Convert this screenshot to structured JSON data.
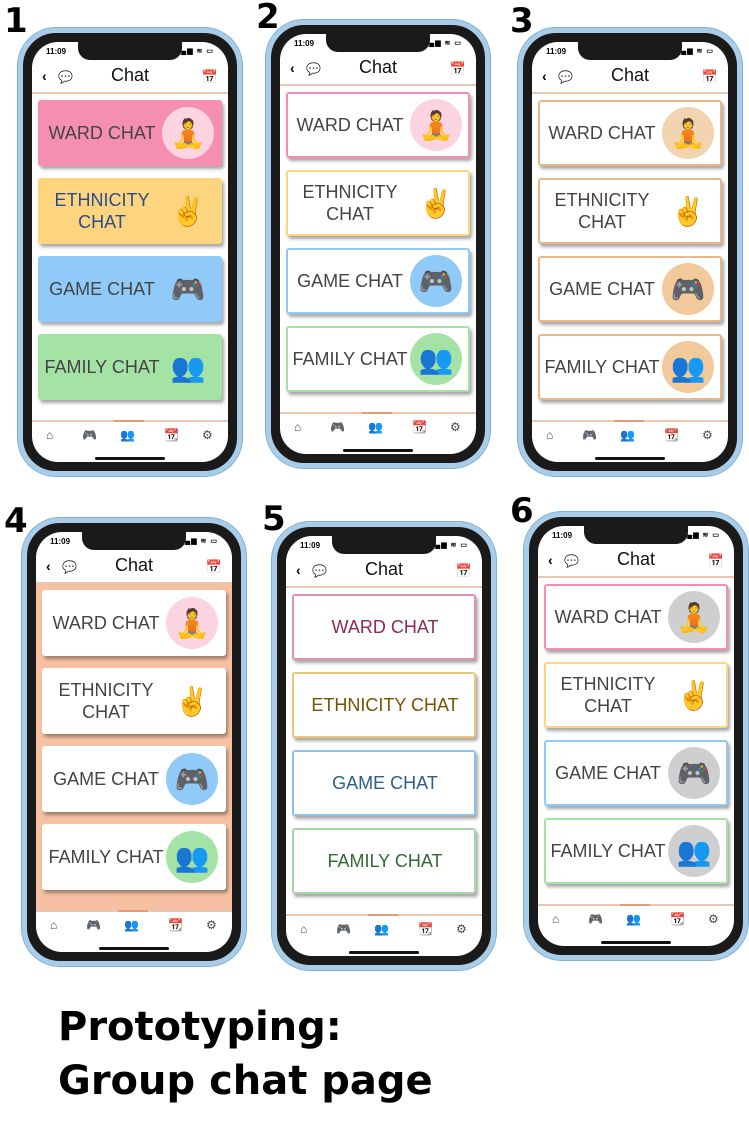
{
  "numbers": [
    "1",
    "2",
    "3",
    "4",
    "5",
    "6"
  ],
  "caption": {
    "line1": "Prototyping:",
    "line2": "Group chat page"
  },
  "phone": {
    "time": "11:09",
    "title": "Chat",
    "signal": "▂▄▆ ≋ ▭",
    "icons": {
      "back": "‹",
      "chat": "💬",
      "calendar": "📅"
    },
    "tabs": [
      "⌂",
      "🎮",
      "👥",
      "📆",
      "⚙"
    ]
  },
  "cards": [
    {
      "label": "WARD CHAT",
      "icon": "🧘"
    },
    {
      "label": "ETHNICITY CHAT",
      "icon": "✌"
    },
    {
      "label": "GAME CHAT",
      "icon": "🎮"
    },
    {
      "label": "FAMILY CHAT",
      "icon": "👥"
    }
  ],
  "variants": [
    {
      "id": "1",
      "bg": "#ffffff",
      "cards": [
        {
          "bg": "#f48fb1",
          "border": "#f48fb1",
          "text": "#444",
          "icon_bg": "#fbd3e1"
        },
        {
          "bg": "#fdd57e",
          "border": "#fdd57e",
          "text": "#2e4a8b",
          "icon_bg": "#fdd57e"
        },
        {
          "bg": "#90caf9",
          "border": "#90caf9",
          "text": "#444",
          "icon_bg": "#90caf9"
        },
        {
          "bg": "#a5e2a5",
          "border": "#a5e2a5",
          "text": "#444",
          "icon_bg": "#a5e2a5"
        }
      ]
    },
    {
      "id": "2",
      "bg": "#ffffff",
      "cards": [
        {
          "bg": "#ffffff",
          "border": "#f48fb1",
          "text": "#444",
          "icon_bg": "#fbd3e1"
        },
        {
          "bg": "#ffffff",
          "border": "#fdd57e",
          "text": "#444",
          "icon_bg": "#fff"
        },
        {
          "bg": "#ffffff",
          "border": "#90caf9",
          "text": "#444",
          "icon_bg": "#90caf9"
        },
        {
          "bg": "#ffffff",
          "border": "#a5e2a5",
          "text": "#444",
          "icon_bg": "#a5e2a5"
        }
      ]
    },
    {
      "id": "3",
      "bg": "#ffffff",
      "cards": [
        {
          "bg": "#ffffff",
          "border": "#e8b88a",
          "text": "#444",
          "icon_bg": "#f2d3b0"
        },
        {
          "bg": "#ffffff",
          "border": "#e8b88a",
          "text": "#444",
          "icon_bg": "#fff"
        },
        {
          "bg": "#ffffff",
          "border": "#e8b88a",
          "text": "#444",
          "icon_bg": "#f2c99a"
        },
        {
          "bg": "#ffffff",
          "border": "#e8b88a",
          "text": "#444",
          "icon_bg": "#f2c99a"
        }
      ]
    },
    {
      "id": "4",
      "bg": "#f6c0a2",
      "cards": [
        {
          "bg": "#ffffff",
          "border": "#ffffff",
          "text": "#444",
          "icon_bg": "#fbd3e1"
        },
        {
          "bg": "#ffffff",
          "border": "#ffffff",
          "text": "#444",
          "icon_bg": "#fff"
        },
        {
          "bg": "#ffffff",
          "border": "#ffffff",
          "text": "#444",
          "icon_bg": "#90caf9"
        },
        {
          "bg": "#ffffff",
          "border": "#ffffff",
          "text": "#444",
          "icon_bg": "#a5e2a5"
        }
      ]
    },
    {
      "id": "5",
      "bg": "#ffffff",
      "cards": [
        {
          "bg": "#ffffff",
          "border": "#e090b0",
          "text": "#8c2a55",
          "icon_bg": ""
        },
        {
          "bg": "#ffffff",
          "border": "#e8c87a",
          "text": "#7a5200",
          "icon_bg": ""
        },
        {
          "bg": "#ffffff",
          "border": "#90bfe8",
          "text": "#2a5f8c",
          "icon_bg": ""
        },
        {
          "bg": "#ffffff",
          "border": "#a5d8a5",
          "text": "#2f6b2f",
          "icon_bg": ""
        }
      ]
    },
    {
      "id": "6",
      "bg": "#ffffff",
      "cards": [
        {
          "bg": "#ffffff",
          "border": "#f48fb1",
          "text": "#444",
          "icon_bg": "#cfcfcf"
        },
        {
          "bg": "#ffffff",
          "border": "#fdd57e",
          "text": "#444",
          "icon_bg": "#fff"
        },
        {
          "bg": "#ffffff",
          "border": "#90caf9",
          "text": "#444",
          "icon_bg": "#cfcfcf"
        },
        {
          "bg": "#ffffff",
          "border": "#a5e2a5",
          "text": "#444",
          "icon_bg": "#cfcfcf"
        }
      ]
    }
  ]
}
